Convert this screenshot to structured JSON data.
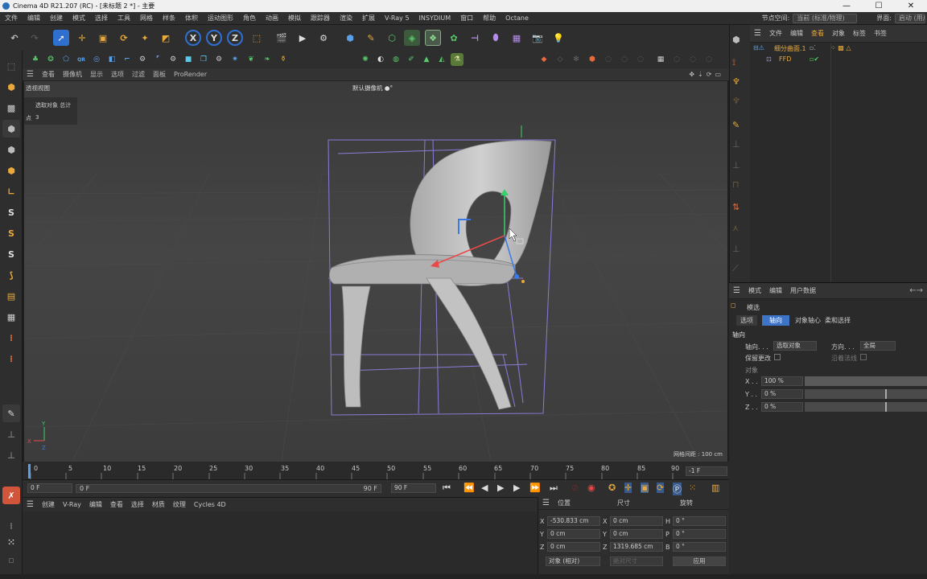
{
  "window": {
    "title": "Cinema 4D R21.207 (RC) - [未标题 2 *] - 主要",
    "controls": [
      "—",
      "☐",
      "✕"
    ]
  },
  "menubar": {
    "items": [
      "文件",
      "编辑",
      "创建",
      "模式",
      "选择",
      "工具",
      "网格",
      "样条",
      "体积",
      "运动图形",
      "角色",
      "动画",
      "模拟",
      "跟踪器",
      "渲染",
      "扩展",
      "V-Ray 5",
      "INSYDIUM",
      "窗口",
      "帮助",
      "Octane"
    ],
    "node_space_label": "节点空间:",
    "node_space_value": "当前 (标准/物理)",
    "layout_label": "界面:",
    "layout_value": "启动 (用户)"
  },
  "toolbar": {
    "axis_x": "X",
    "axis_y": "Y",
    "axis_z": "Z"
  },
  "viewport": {
    "menu": [
      "查看",
      "摄像机",
      "显示",
      "选项",
      "过滤",
      "面板",
      "ProRender"
    ],
    "name": "透视视图",
    "camera": "默认摄像机 ●°",
    "info_header": "选取对象 总计",
    "info_point_label": "点",
    "info_point_value": "3",
    "grid_spacing": "网格间距 : 100 cm"
  },
  "timeline": {
    "ticks": [
      "0",
      "5",
      "10",
      "15",
      "20",
      "25",
      "30",
      "35",
      "40",
      "45",
      "50",
      "55",
      "60",
      "65",
      "70",
      "75",
      "80",
      "85",
      "90"
    ],
    "current_frame": "-1 F"
  },
  "playback": {
    "start": "0 F",
    "min": "0 F",
    "max": "90 F",
    "end": "90 F"
  },
  "material": {
    "menu": [
      "创建",
      "V-Ray",
      "编辑",
      "查看",
      "选择",
      "材质",
      "纹理",
      "Cycles 4D"
    ]
  },
  "coords": {
    "headers": [
      "位置",
      "尺寸",
      "旋转"
    ],
    "rows": [
      {
        "pos_axis": "X",
        "pos": "-530.833 cm",
        "size_axis": "X",
        "size": "0 cm",
        "rot_axis": "H",
        "rot": "0 °"
      },
      {
        "pos_axis": "Y",
        "pos": "0 cm",
        "size_axis": "Y",
        "size": "0 cm",
        "rot_axis": "P",
        "rot": "0 °"
      },
      {
        "pos_axis": "Z",
        "pos": "0 cm",
        "size_axis": "Z",
        "size": "1319.685 cm",
        "rot_axis": "B",
        "rot": "0 °"
      }
    ],
    "mode": "对象 (相对)",
    "size_mode": "绝对尺寸",
    "apply": "应用"
  },
  "object_manager": {
    "menu": [
      "文件",
      "编辑",
      "查看",
      "对象",
      "标签",
      "书签"
    ],
    "objects": [
      {
        "name": "细分曲面.1"
      },
      {
        "name": "FFD"
      }
    ]
  },
  "attributes": {
    "menu": [
      "模式",
      "编辑",
      "用户数据"
    ],
    "title": "模选",
    "tabs": [
      "选项",
      "轴向",
      "对象轴心",
      "柔和选择"
    ],
    "section": "轴向",
    "axis_label": "轴向. . .",
    "axis_value": "选取对象",
    "direction_label": "方向. . .",
    "direction_value": "全局",
    "keep_label": "保留更改",
    "align_label": "沿着法线",
    "object_label": "对象",
    "x_label": "X . .",
    "x_value": "100 %",
    "y_label": "Y . .",
    "y_value": "0 %",
    "z_label": "Z . .",
    "z_value": "0 %"
  },
  "status": {
    "text": ""
  }
}
